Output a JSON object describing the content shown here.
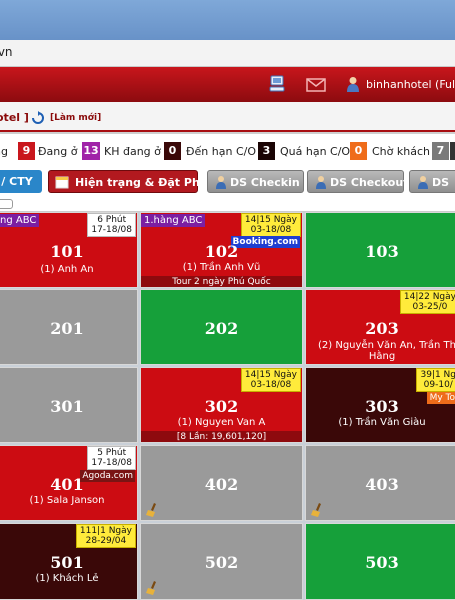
{
  "browser": {
    "url_fragment": ".vn"
  },
  "header": {
    "user_label": "binhanhotel (Full Ac"
  },
  "title_bar": {
    "title": "otel ]",
    "refresh_link": "[Làm mới]"
  },
  "legend": [
    {
      "text": "ng"
    },
    {
      "count": "9",
      "label": "Đang ở",
      "color": "#c9171d"
    },
    {
      "count": "13",
      "label": "KH đang ở",
      "color": "#a023a8"
    },
    {
      "count": "0",
      "label": "Đến hạn C/O",
      "color": "#3a0808"
    },
    {
      "count": "3",
      "label": "Quá hạn C/O",
      "color": "#1a0505"
    },
    {
      "count": "0",
      "label": "Chờ khách",
      "color": "#ef6c1a"
    },
    {
      "count": "7",
      "label": "",
      "color": "#7a7a7a"
    }
  ],
  "toolbar": {
    "cty_label": "/ CTY",
    "status_booking_label": "Hiện trạng & Đặt Phòng",
    "checkin_label": "DS Checkin",
    "checkout_label": "DS Checkout",
    "ds_label": "DS"
  },
  "rooms": [
    {
      "number": "101",
      "guest": "(1) Anh An",
      "purple_tag": "ng ABC",
      "white_tag": [
        "6 Phút",
        "17-18/08"
      ]
    },
    {
      "number": "102",
      "guest": "(1) Trần Anh Vũ",
      "purple_tag": "1.hàng ABC",
      "yellow_tag": [
        "14|15 Ngày",
        "03-18/08"
      ],
      "booking": "Booking.com",
      "footer": "Tour 2 ngày Phú Quốc"
    },
    {
      "number": "103"
    },
    {
      "number": "201"
    },
    {
      "number": "202"
    },
    {
      "number": "203",
      "guest": "(2) Nguyễn Văn An, Trần Thanh",
      "guest2": "Hằng",
      "yellow_tag": [
        "14|22 Ngày",
        "03-25/0"
      ]
    },
    {
      "number": "301"
    },
    {
      "number": "302",
      "guest": "(1) Nguyen Van A",
      "yellow_tag": [
        "14|15 Ngày",
        "03-18/08"
      ],
      "footer": "[8 Lần: 19,601,120]"
    },
    {
      "number": "303",
      "guest": "(1) Trần Văn Giàu",
      "yellow_tag": [
        "39|1 Ng",
        "09-10/"
      ],
      "orange_tag": "My To"
    },
    {
      "number": "401",
      "guest": "(1) Sala Janson",
      "white_tag": [
        "5 Phút",
        "17-18/08"
      ],
      "agoda": "Agoda.com"
    },
    {
      "number": "402"
    },
    {
      "number": "403"
    },
    {
      "number": "501",
      "guest": "(1) Khách Lẻ",
      "yellow_tag": [
        "111|1 Ngày",
        "28-29/04"
      ]
    },
    {
      "number": "502"
    },
    {
      "number": "503"
    }
  ],
  "colors": {
    "occupied": "#cc0c12",
    "vacant": "#16a03a",
    "dirty": "#9a9a9a",
    "overdue": "#3a0808"
  }
}
